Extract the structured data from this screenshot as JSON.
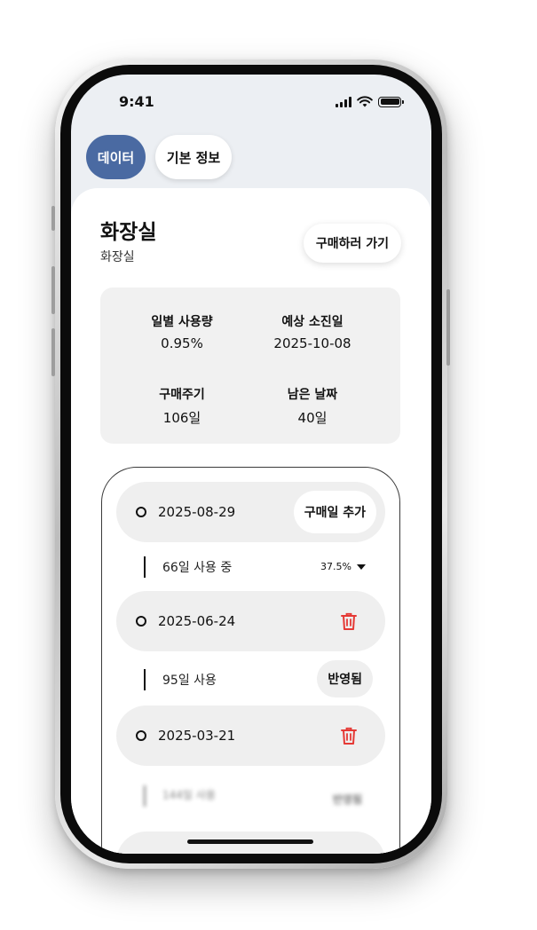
{
  "status_bar": {
    "time": "9:41"
  },
  "tabs": [
    {
      "label": "데이터",
      "active": true
    },
    {
      "label": "기본 정보",
      "active": false
    }
  ],
  "item": {
    "title": "화장실",
    "subtitle": "화장실",
    "buy_button_label": "구매하러 가기"
  },
  "stats": {
    "daily_usage": {
      "label": "일별 사용량",
      "value": "0.95%"
    },
    "expected_depletion": {
      "label": "예상 소진일",
      "value": "2025-10-08"
    },
    "purchase_cycle": {
      "label": "구매주기",
      "value": "106일"
    },
    "remaining_days": {
      "label": "남은 날짜",
      "value": "40일"
    }
  },
  "history": {
    "add_button_label": "구매일 추가",
    "entries": [
      {
        "date": "2025-08-29"
      },
      {
        "date": "2025-06-24"
      },
      {
        "date": "2025-03-21"
      }
    ],
    "gaps": [
      {
        "text": "66일 사용 중",
        "percent": "37.5%"
      },
      {
        "text": "95일 사용",
        "status": "반영됨"
      },
      {
        "text": "144일 사용",
        "status": "반영됨"
      }
    ]
  },
  "colors": {
    "accent": "#4a6aa2",
    "danger": "#e53935",
    "card_bg": "#f1f1f1"
  },
  "icons": {
    "home": "home-icon",
    "add": "plus-icon",
    "profile": "user-icon",
    "delete": "trash-icon"
  }
}
